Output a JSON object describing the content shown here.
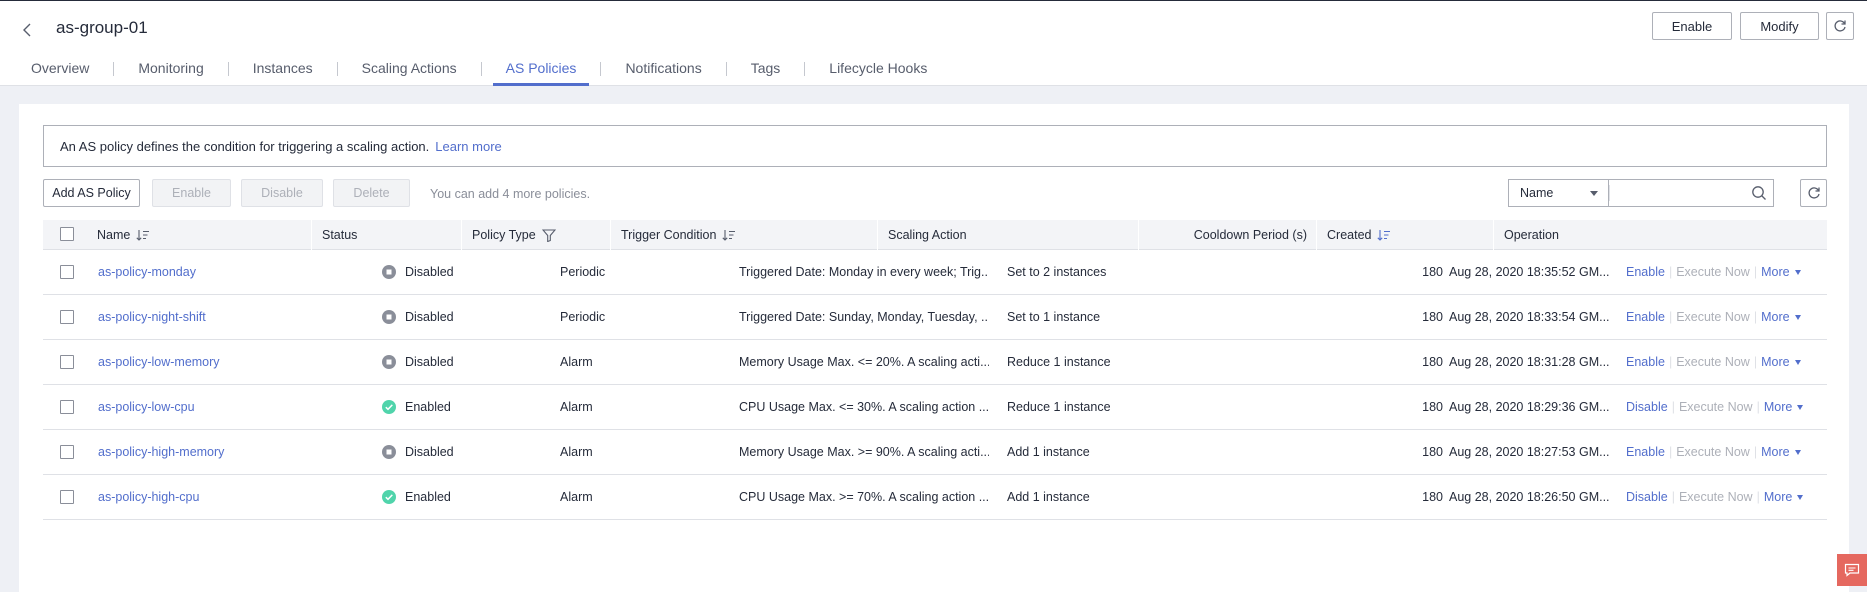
{
  "header": {
    "title": "as-group-01",
    "enable_label": "Enable",
    "modify_label": "Modify"
  },
  "tabs": [
    {
      "label": "Overview"
    },
    {
      "label": "Monitoring"
    },
    {
      "label": "Instances"
    },
    {
      "label": "Scaling Actions"
    },
    {
      "label": "AS Policies",
      "active": true
    },
    {
      "label": "Notifications"
    },
    {
      "label": "Tags"
    },
    {
      "label": "Lifecycle Hooks"
    }
  ],
  "info": {
    "text": "An AS policy defines the condition for triggering a scaling action.",
    "link": "Learn more"
  },
  "toolbar": {
    "add_label": "Add AS Policy",
    "enable_label": "Enable",
    "disable_label": "Disable",
    "delete_label": "Delete",
    "quota_text": "You can add 4 more policies.",
    "filter_value": "Name",
    "search_placeholder": ""
  },
  "table": {
    "columns": {
      "name": "Name",
      "status": "Status",
      "policy_type": "Policy Type",
      "trigger": "Trigger Condition",
      "action": "Scaling Action",
      "cooldown": "Cooldown Period (s)",
      "created": "Created",
      "operation": "Operation"
    },
    "rows": [
      {
        "name": "as-policy-monday",
        "status": "Disabled",
        "type": "Periodic",
        "trigger": "Triggered Date: Monday in every week; Trig...",
        "action": "Set to 2 instances",
        "cooldown": "180",
        "created": "Aug 28, 2020 18:35:52 GM...",
        "toggle": "Enable",
        "execute": "Execute Now",
        "more": "More"
      },
      {
        "name": "as-policy-night-shift",
        "status": "Disabled",
        "type": "Periodic",
        "trigger": "Triggered Date: Sunday, Monday, Tuesday, ...",
        "action": "Set to 1 instance",
        "cooldown": "180",
        "created": "Aug 28, 2020 18:33:54 GM...",
        "toggle": "Enable",
        "execute": "Execute Now",
        "more": "More"
      },
      {
        "name": "as-policy-low-memory",
        "status": "Disabled",
        "type": "Alarm",
        "trigger": "Memory Usage Max. <= 20%. A scaling acti...",
        "action": "Reduce 1 instance",
        "cooldown": "180",
        "created": "Aug 28, 2020 18:31:28 GM...",
        "toggle": "Enable",
        "execute": "Execute Now",
        "more": "More"
      },
      {
        "name": "as-policy-low-cpu",
        "status": "Enabled",
        "type": "Alarm",
        "trigger": "CPU Usage Max. <= 30%. A scaling action ...",
        "action": "Reduce 1 instance",
        "cooldown": "180",
        "created": "Aug 28, 2020 18:29:36 GM...",
        "toggle": "Disable",
        "execute": "Execute Now",
        "more": "More"
      },
      {
        "name": "as-policy-high-memory",
        "status": "Disabled",
        "type": "Alarm",
        "trigger": "Memory Usage Max. >= 90%. A scaling acti...",
        "action": "Add 1 instance",
        "cooldown": "180",
        "created": "Aug 28, 2020 18:27:53 GM...",
        "toggle": "Enable",
        "execute": "Execute Now",
        "more": "More"
      },
      {
        "name": "as-policy-high-cpu",
        "status": "Enabled",
        "type": "Alarm",
        "trigger": "CPU Usage Max. >= 70%. A scaling action ...",
        "action": "Add 1 instance",
        "cooldown": "180",
        "created": "Aug 28, 2020 18:26:50 GM...",
        "toggle": "Disable",
        "execute": "Execute Now",
        "more": "More"
      }
    ]
  },
  "colors": {
    "accent": "#526ecc",
    "enabled": "#50d4ab",
    "disabled": "#8a8e99"
  }
}
